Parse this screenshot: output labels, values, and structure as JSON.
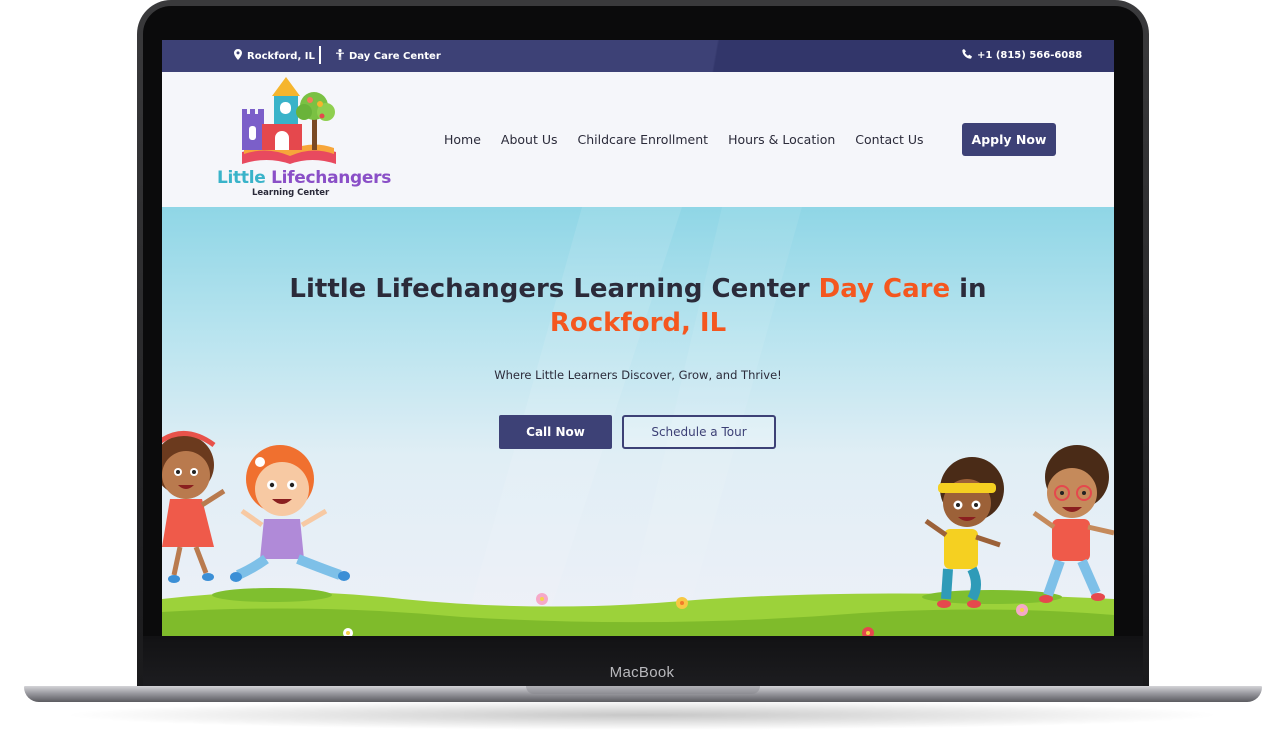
{
  "device": {
    "brand_label": "MacBook"
  },
  "topbar": {
    "location": "Rockford, IL",
    "category": "Day Care Center",
    "phone": "+1 (815) 566-6088",
    "background_color": "#3d4176",
    "icons": [
      "map-pin-icon",
      "child-icon",
      "phone-icon"
    ]
  },
  "logo": {
    "name_word1": "Little",
    "name_word2": "Lifechangers",
    "subtitle": "Learning Center"
  },
  "nav": {
    "items": [
      {
        "label": "Home"
      },
      {
        "label": "About Us"
      },
      {
        "label": "Childcare Enrollment"
      },
      {
        "label": "Hours & Location"
      },
      {
        "label": "Contact Us"
      }
    ],
    "cta_label": "Apply Now"
  },
  "hero": {
    "title_part1": "Little Lifechangers Learning Center ",
    "title_accent1": "Day Care",
    "title_part2": " in",
    "title_accent2": "Rockford, IL",
    "subtitle": "Where Little Learners Discover, Grow, and Thrive!",
    "primary_cta": "Call Now",
    "secondary_cta": "Schedule a Tour",
    "accent_color": "#f4571f",
    "brand_color": "#3d4176"
  }
}
